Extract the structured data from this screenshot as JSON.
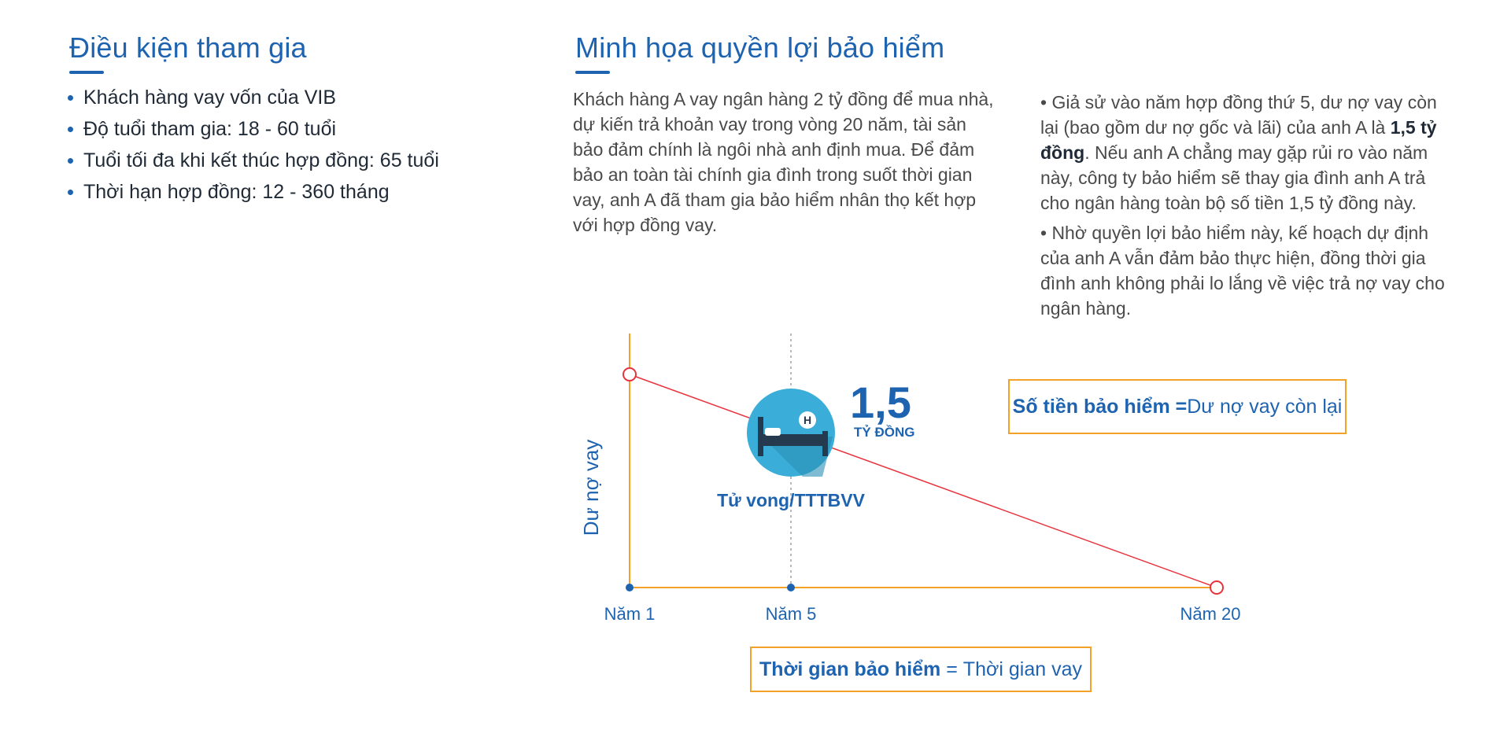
{
  "conditions": {
    "title": "Điều kiện tham gia",
    "items": [
      "Khách hàng vay vốn của VIB",
      "Độ tuổi tham gia: 18 - 60 tuổi",
      "Tuổi tối đa khi kết thúc hợp đồng: 65 tuổi",
      "Thời hạn hợp đồng: 12 - 360 tháng"
    ]
  },
  "illustration": {
    "title": "Minh họa quyền lợi bảo hiểm",
    "intro": "Khách hàng A vay ngân hàng 2 tỷ đồng để mua nhà, dự kiến trả khoản vay trong vòng 20 năm, tài sản bảo đảm chính là ngôi nhà anh định mua. Để đảm bảo an toàn tài chính gia đình trong suốt thời gian vay, anh A đã tham gia bảo hiểm nhân thọ kết hợp với hợp đồng vay.",
    "note1_pre": "• Giả sử vào năm hợp đồng thứ 5, dư nợ vay còn lại (bao gồm dư nợ gốc và lãi) của anh A là ",
    "note1_bold": "1,5 tỷ đồng",
    "note1_post": ".  Nếu anh A chẳng may gặp rủi ro vào năm này, công ty bảo hiểm sẽ thay gia đình anh A trả cho ngân hàng toàn bộ số tiền 1,5 tỷ đồng này.",
    "note2": "• Nhờ quyền lợi bảo hiểm này, kế hoạch dự định của anh A vẫn đảm bảo thực hiện, đồng thời gia đình anh không phải lo lắng về việc trả nợ vay cho ngân hàng."
  },
  "chart_data": {
    "type": "line",
    "ylabel": "Dư nợ vay",
    "x_labels": [
      "Năm 1",
      "Năm 5",
      "Năm 20"
    ],
    "x": [
      1,
      5,
      20
    ],
    "highlight": {
      "x": 5,
      "value": "1,5",
      "unit": "TỶ ĐỒNG",
      "event": "Tử vong/TTTBVV",
      "icon": "hospital-bed-icon"
    },
    "colors": {
      "axis": "#f4a12a",
      "line": "#e8323c",
      "text": "#1e63b0",
      "icon_bg": "#3aaed8"
    }
  },
  "boxes": {
    "sum_bold": "Số tiền bảo hiểm =",
    "sum_light": " Dư nợ vay còn lại",
    "time_bold": "Thời gian bảo hiểm ",
    "time_eq": " = ",
    "time_light": "Thời gian vay"
  }
}
